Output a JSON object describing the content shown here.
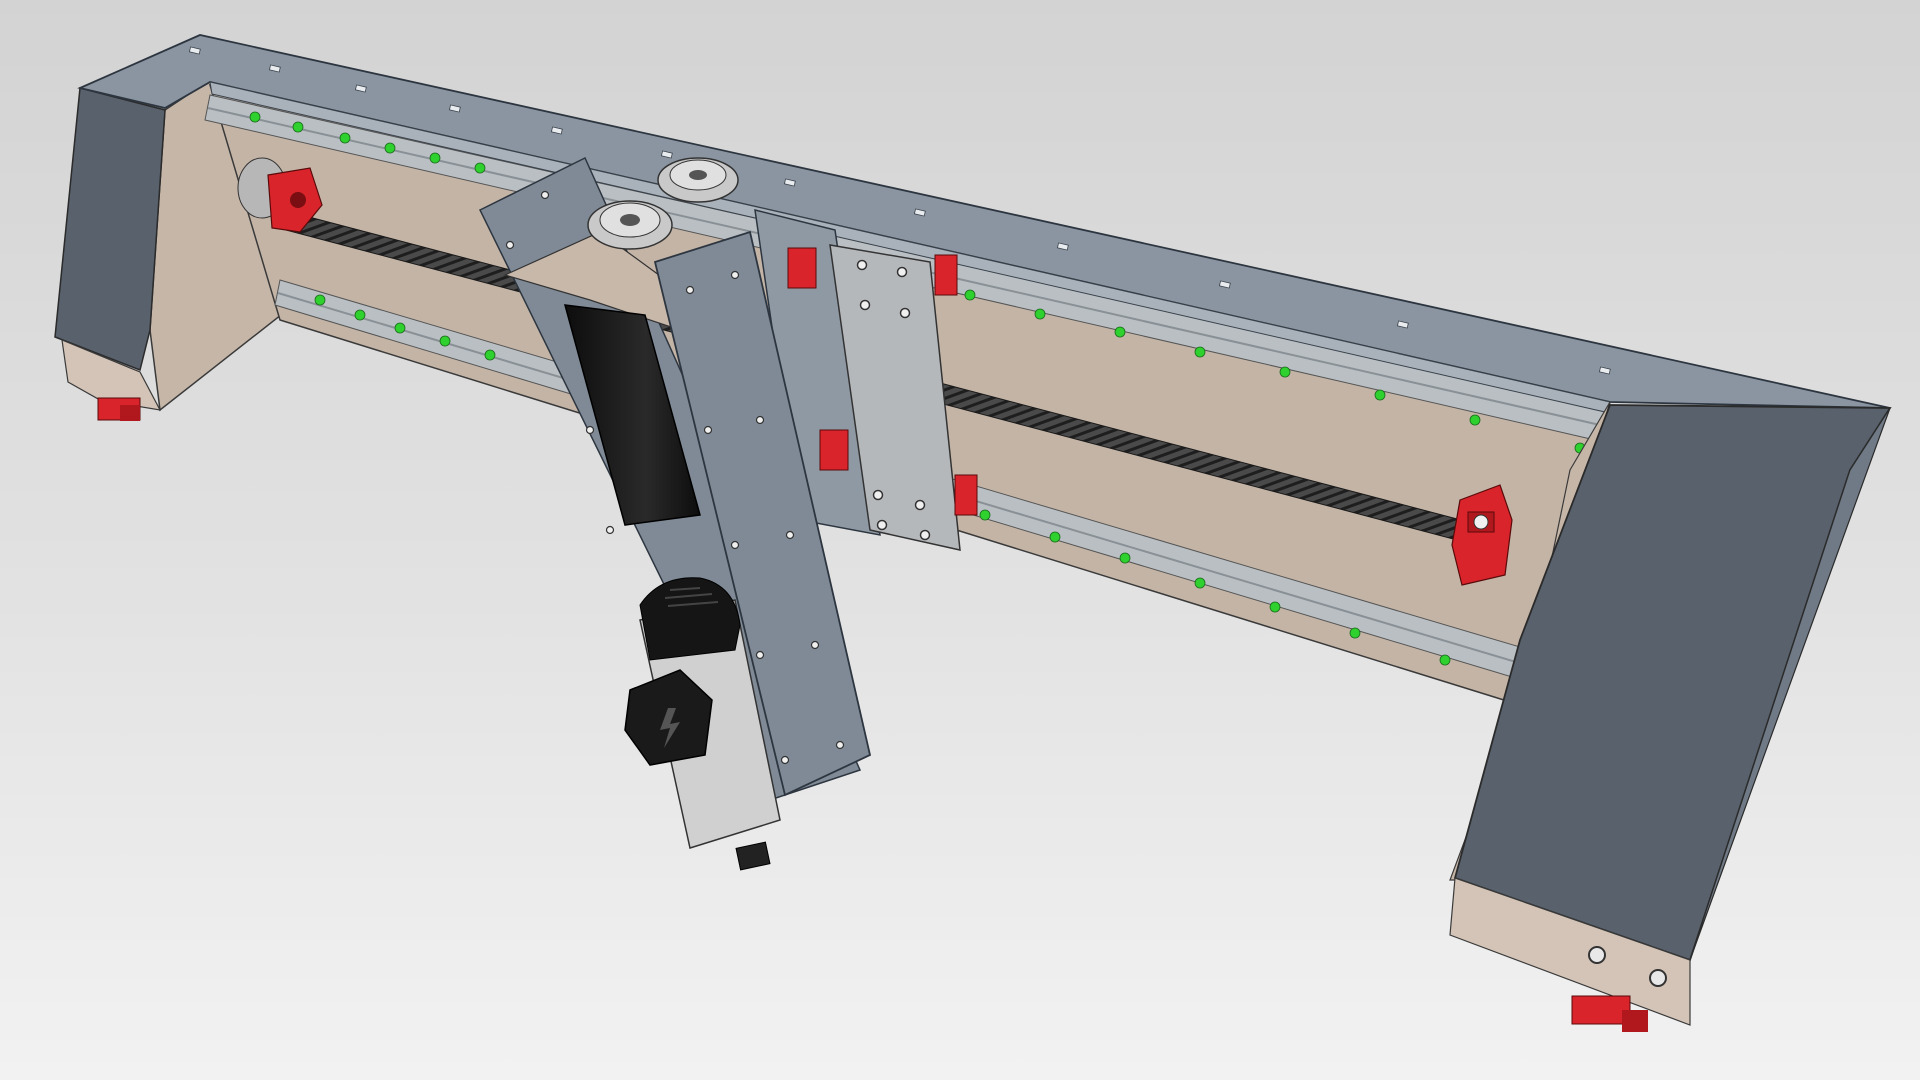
{
  "viewport": {
    "background_top": "#d3d3d3",
    "background_bottom": "#f2f2f2"
  },
  "colors": {
    "frame_top": "#8a95a1",
    "frame_side": "#59626d",
    "inner_panel": "#c8b8aa",
    "rail": "#b9bfc3",
    "rail_ball": "#2fd12f",
    "bearing_block": "#d8242a",
    "carriage_plate": "#7f8a96",
    "z_plate": "#b2b5b8",
    "stepper": "#151515",
    "spindle_body": "#d0d0d0",
    "leadscrew": "#3b3b3b"
  },
  "model": {
    "icon": "cnc-gantry-icon"
  }
}
